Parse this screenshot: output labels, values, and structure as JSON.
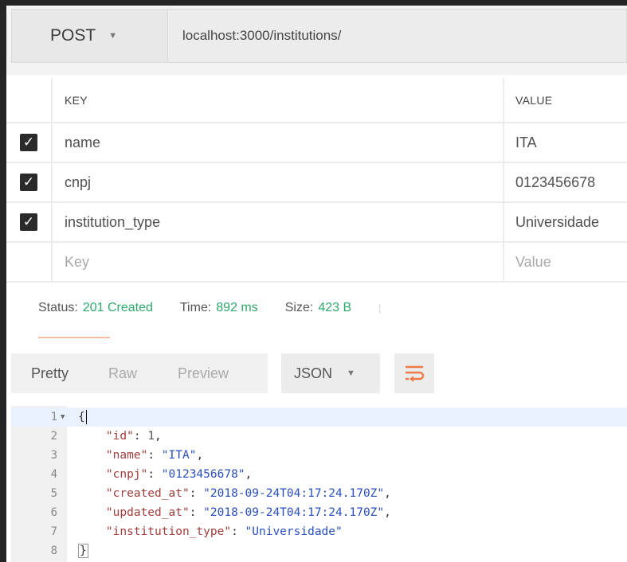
{
  "request": {
    "method": "POST",
    "url": "localhost:3000/institutions/"
  },
  "params": {
    "header_key": "KEY",
    "header_value": "VALUE",
    "rows": [
      {
        "key": "name",
        "value": "ITA"
      },
      {
        "key": "cnpj",
        "value": "0123456678"
      },
      {
        "key": "institution_type",
        "value": "Universidade"
      }
    ],
    "placeholder_key": "Key",
    "placeholder_value": "Value"
  },
  "status": {
    "status_label": "Status:",
    "status_value": "201 Created",
    "time_label": "Time:",
    "time_value": "892 ms",
    "size_label": "Size:",
    "size_value": "423 B"
  },
  "response_toolbar": {
    "tabs": [
      "Pretty",
      "Raw",
      "Preview"
    ],
    "format": "JSON"
  },
  "response_body": {
    "line_numbers": [
      "1",
      "2",
      "3",
      "4",
      "5",
      "6",
      "7",
      "8"
    ],
    "id_key": "\"id\"",
    "id_value": "1",
    "name_key": "\"name\"",
    "name_value": "\"ITA\"",
    "cnpj_key": "\"cnpj\"",
    "cnpj_value": "\"0123456678\"",
    "created_key": "\"created_at\"",
    "created_value": "\"2018-09-24T04:17:24.170Z\"",
    "updated_key": "\"updated_at\"",
    "updated_value": "\"2018-09-24T04:17:24.170Z\"",
    "type_key": "\"institution_type\"",
    "type_value": "\"Universidade\""
  },
  "colors": {
    "status_green": "#2ea86b",
    "wrap_orange": "#f07a48",
    "json_key": "#a33c3c",
    "json_string": "#2a4fbf"
  },
  "icons": {
    "checkbox": "check-icon",
    "wrap": "wrap-lines-icon",
    "fold": "fold-arrow-icon"
  }
}
